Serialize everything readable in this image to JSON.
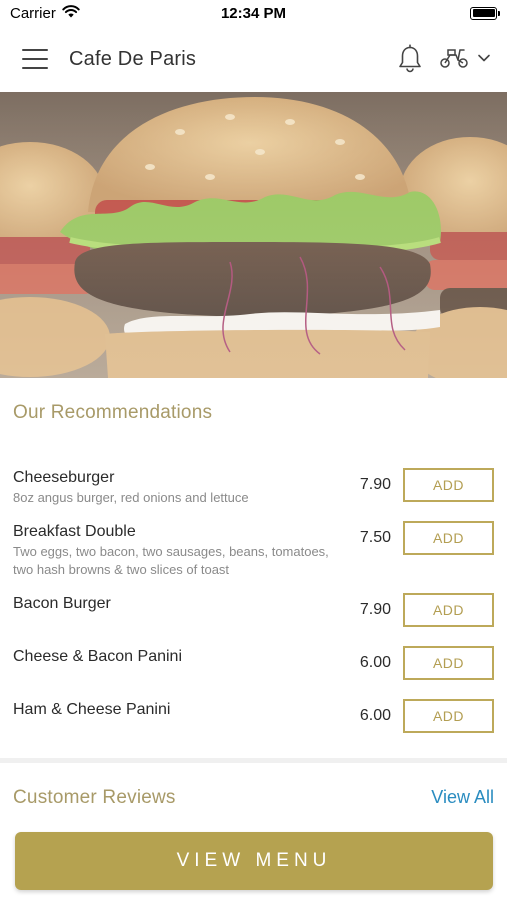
{
  "status_bar": {
    "carrier": "Carrier",
    "time": "12:34 PM"
  },
  "nav": {
    "title": "Cafe De Paris"
  },
  "recommendations": {
    "title": "Our Recommendations",
    "items": [
      {
        "name": "Cheeseburger",
        "description": "8oz angus burger, red onions and lettuce",
        "price": "7.90",
        "add_label": "ADD"
      },
      {
        "name": "Breakfast Double",
        "description": "Two eggs, two bacon, two sausages, beans, tomatoes, two hash browns & two slices of toast",
        "price": "7.50",
        "add_label": "ADD"
      },
      {
        "name": "Bacon Burger",
        "description": "",
        "price": "7.90",
        "add_label": "ADD"
      },
      {
        "name": "Cheese & Bacon Panini",
        "description": "",
        "price": "6.00",
        "add_label": "ADD"
      },
      {
        "name": "Ham & Cheese Panini",
        "description": "",
        "price": "6.00",
        "add_label": "ADD"
      }
    ]
  },
  "reviews": {
    "title": "Customer Reviews",
    "view_all_label": "View All"
  },
  "footer": {
    "view_menu_label": "VIEW MENU"
  },
  "colors": {
    "accent_gold": "#b5a250",
    "section_title": "#a89a68",
    "link_blue": "#2a8cc0"
  },
  "icons": {
    "menu": "hamburger-icon",
    "notifications": "bell-icon",
    "delivery": "scooter-icon",
    "dropdown": "chevron-down-icon",
    "wifi": "wifi-icon",
    "battery": "battery-icon"
  }
}
